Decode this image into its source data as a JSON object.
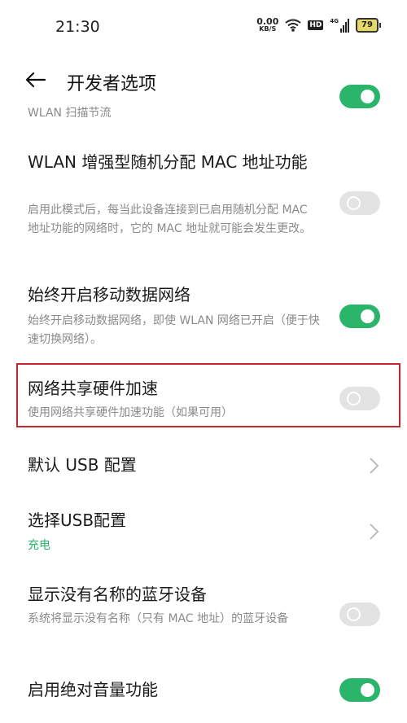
{
  "status_bar": {
    "time": "21:30",
    "net_speed_value": "0.00",
    "net_speed_unit": "KB/S",
    "hd_label": "HD",
    "signal_label": "4G",
    "battery": "79",
    "icons": [
      "wifi-icon",
      "hd-icon",
      "signal-icon",
      "battery-icon"
    ]
  },
  "app_bar": {
    "title": "开发者选项"
  },
  "settings": [
    {
      "title": "",
      "subtitle": "WLAN 扫描节流",
      "toggle": "on"
    },
    {
      "title": "WLAN 增强型随机分配 MAC 地址功能",
      "subtitle": "启用此模式后，每当此设备连接到已启用随机分配 MAC 地址功能的网络时，它的 MAC 地址就可能会发生更改。",
      "toggle": "off"
    },
    {
      "title": "始终开启移动数据网络",
      "subtitle": "始终开启移动数据网络，即使 WLAN 网络已开启（便于快速切换网络）。",
      "toggle": "on"
    },
    {
      "title": "网络共享硬件加速",
      "subtitle": "使用网络共享硬件加速功能（如果可用）",
      "toggle": "off",
      "highlighted": true
    },
    {
      "title": "默认 USB 配置",
      "subtitle": "",
      "control": "chevron"
    },
    {
      "title": "选择USB配置",
      "subtitle": "充电",
      "control": "chevron"
    },
    {
      "title": "显示没有名称的蓝牙设备",
      "subtitle": "系统将显示没有名称（只有 MAC 地址）的蓝牙设备",
      "toggle": "off"
    },
    {
      "title": "启用绝对音量功能",
      "subtitle": "",
      "toggle": "on"
    }
  ],
  "colors": {
    "accent": "#2bb56b",
    "highlight_border": "#c6262e",
    "toggle_off": "#e3e3e3"
  }
}
